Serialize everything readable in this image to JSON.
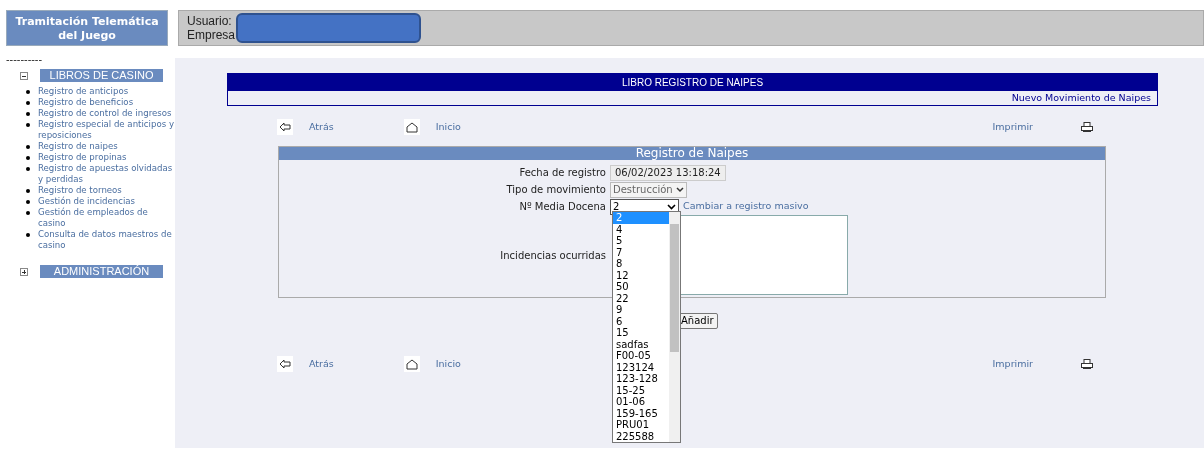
{
  "app_title": "Tramitación Telemática del Juego",
  "user_bar": {
    "user_label": "Usuario:",
    "company_label": "Empresa",
    "redacted": true
  },
  "sidebar": {
    "separator": "----------",
    "sections": [
      {
        "title": "LIBROS DE CASINO",
        "expanded": true,
        "items": [
          "Registro de anticipos",
          "Registro de beneficios",
          "Registro de control de ingresos",
          "Registro especial de anticipos y reposiciones",
          "Registro de naipes",
          "Registro de propinas",
          "Registro de apuestas olvidadas y perdidas",
          "Registro de torneos",
          "Gestión de incidencias",
          "Gestión de empleados de casino",
          "Consulta de datos maestros de casino"
        ]
      },
      {
        "title": "ADMINISTRACIÓN",
        "expanded": false
      }
    ]
  },
  "page_header": {
    "title": "LIBRO REGISTRO DE NAIPES",
    "subtitle": "Nuevo Movimiento de Naipes"
  },
  "nav_top": {
    "back": "Atrás",
    "home": "Inicio",
    "print": "Imprimir"
  },
  "form": {
    "title": "Registro de Naipes",
    "date_label": "Fecha de registro",
    "date_value": "06/02/2023 13:18:24",
    "type_label": "Tipo de movimiento",
    "type_value": "Destrucción",
    "dozen_label": "Nº Media Docena",
    "dozen_value": "2",
    "bulk_link": "Cambiar a registro masivo",
    "incidents_label": "Incidencias ocurridas",
    "add_button": "Añadir",
    "dropdown": {
      "open": true,
      "options": [
        {
          "label": "2",
          "selected": true
        },
        {
          "label": "4",
          "selected": false
        },
        {
          "label": "5",
          "selected": false
        },
        {
          "label": "7",
          "selected": false
        },
        {
          "label": "8",
          "selected": false
        },
        {
          "label": "12",
          "selected": false
        },
        {
          "label": "50",
          "selected": false
        },
        {
          "label": "22",
          "selected": false
        },
        {
          "label": "9",
          "selected": false
        },
        {
          "label": "6",
          "selected": false
        },
        {
          "label": "15",
          "selected": false
        },
        {
          "label": "sadfas",
          "selected": false
        },
        {
          "label": "F00-05",
          "selected": false
        },
        {
          "label": "123124",
          "selected": false
        },
        {
          "label": "123-128",
          "selected": false
        },
        {
          "label": "15-25",
          "selected": false
        },
        {
          "label": "01-06",
          "selected": false
        },
        {
          "label": "159-165",
          "selected": false
        },
        {
          "label": "PRU01",
          "selected": false
        },
        {
          "label": "225588",
          "selected": false
        }
      ]
    }
  },
  "nav_bottom": {
    "back": "Atrás",
    "home": "Inicio",
    "print": "Imprimir"
  }
}
